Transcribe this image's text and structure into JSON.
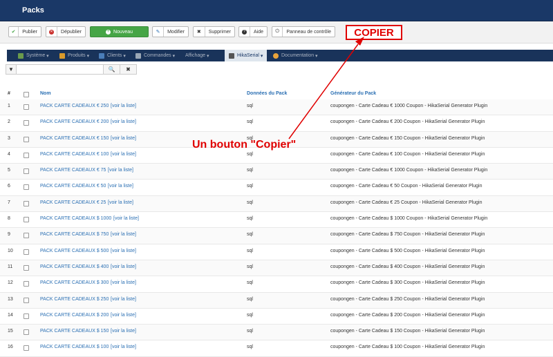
{
  "header": {
    "title": "Packs"
  },
  "toolbar": {
    "publish": "Publier",
    "unpublish": "Dépublier",
    "new": "Nouveau",
    "edit": "Modifier",
    "delete": "Supprimer",
    "help": "Aide",
    "control_panel": "Panneau de contrôle"
  },
  "annotation": {
    "copier_box": "COPIER",
    "note": "Un bouton \"Copier\"",
    "color": "#e00000"
  },
  "nav": {
    "items": [
      "Système",
      "Produits",
      "Clients",
      "Commandes",
      "Affichage",
      "HikaSerial",
      "Documentation"
    ],
    "active": "HikaSerial"
  },
  "filter": {
    "search_placeholder": "",
    "search_value": ""
  },
  "table": {
    "headers": {
      "num": "#",
      "name": "Nom",
      "data": "Données du Pack",
      "generator": "Générateur du Pack"
    },
    "link_label": "[voir la liste]",
    "rows": [
      {
        "num": "1",
        "name": "PACK CARTE CADEAUX € 250",
        "data": "sql",
        "generator": "coupongen - Carte Cadeau € 1000 Coupon - HikaSerial Generator Plugin"
      },
      {
        "num": "2",
        "name": "PACK CARTE CADEAUX € 200",
        "data": "sql",
        "generator": "coupongen - Carte Cadeau € 200 Coupon - HikaSerial Generator Plugin"
      },
      {
        "num": "3",
        "name": "PACK CARTE CADEAUX € 150",
        "data": "sql",
        "generator": "coupongen - Carte Cadeau € 150 Coupon - HikaSerial Generator Plugin"
      },
      {
        "num": "4",
        "name": "PACK CARTE CADEAUX € 100",
        "data": "sql",
        "generator": "coupongen - Carte Cadeau € 100 Coupon - HikaSerial Generator Plugin"
      },
      {
        "num": "5",
        "name": "PACK CARTE CADEAUX € 75",
        "data": "sql",
        "generator": "coupongen - Carte Cadeau € 1000 Coupon - HikaSerial Generator Plugin"
      },
      {
        "num": "6",
        "name": "PACK CARTE CADEAUX € 50",
        "data": "sql",
        "generator": "coupongen - Carte Cadeau € 50 Coupon - HikaSerial Generator Plugin"
      },
      {
        "num": "7",
        "name": "PACK CARTE CADEAUX € 25",
        "data": "sql",
        "generator": "coupongen - Carte Cadeau € 25 Coupon - HikaSerial Generator Plugin"
      },
      {
        "num": "8",
        "name": "PACK CARTE CADEAUX $ 1000",
        "data": "sql",
        "generator": "coupongen - Carte Cadeau $ 1000 Coupon - HikaSerial Generator Plugin"
      },
      {
        "num": "9",
        "name": "PACK CARTE CADEAUX $ 750",
        "data": "sql",
        "generator": "coupongen - Carte Cadeau $ 750 Coupon - HikaSerial Generator Plugin"
      },
      {
        "num": "10",
        "name": "PACK CARTE CADEAUX $ 500",
        "data": "sql",
        "generator": "coupongen - Carte Cadeau $ 500 Coupon - HikaSerial Generator Plugin"
      },
      {
        "num": "11",
        "name": "PACK CARTE CADEAUX $ 400",
        "data": "sql",
        "generator": "coupongen - Carte Cadeau $ 400 Coupon - HikaSerial Generator Plugin"
      },
      {
        "num": "12",
        "name": "PACK CARTE CADEAUX $ 300",
        "data": "sql",
        "generator": "coupongen - Carte Cadeau $ 300 Coupon - HikaSerial Generator Plugin"
      },
      {
        "num": "13",
        "name": "PACK CARTE CADEAUX $ 250",
        "data": "sql",
        "generator": "coupongen - Carte Cadeau $ 250 Coupon - HikaSerial Generator Plugin"
      },
      {
        "num": "14",
        "name": "PACK CARTE CADEAUX $ 200",
        "data": "sql",
        "generator": "coupongen - Carte Cadeau $ 200 Coupon - HikaSerial Generator Plugin"
      },
      {
        "num": "15",
        "name": "PACK CARTE CADEAUX $ 150",
        "data": "sql",
        "generator": "coupongen - Carte Cadeau $ 150 Coupon - HikaSerial Generator Plugin"
      },
      {
        "num": "16",
        "name": "PACK CARTE CADEAUX $ 100",
        "data": "sql",
        "generator": "coupongen - Carte Cadeau $ 100 Coupon - HikaSerial Generator Plugin"
      }
    ]
  },
  "colors": {
    "header_bg": "#1a3867",
    "nav_bg": "#19335a",
    "link": "#2a6fb3",
    "new_button": "#46a546"
  }
}
